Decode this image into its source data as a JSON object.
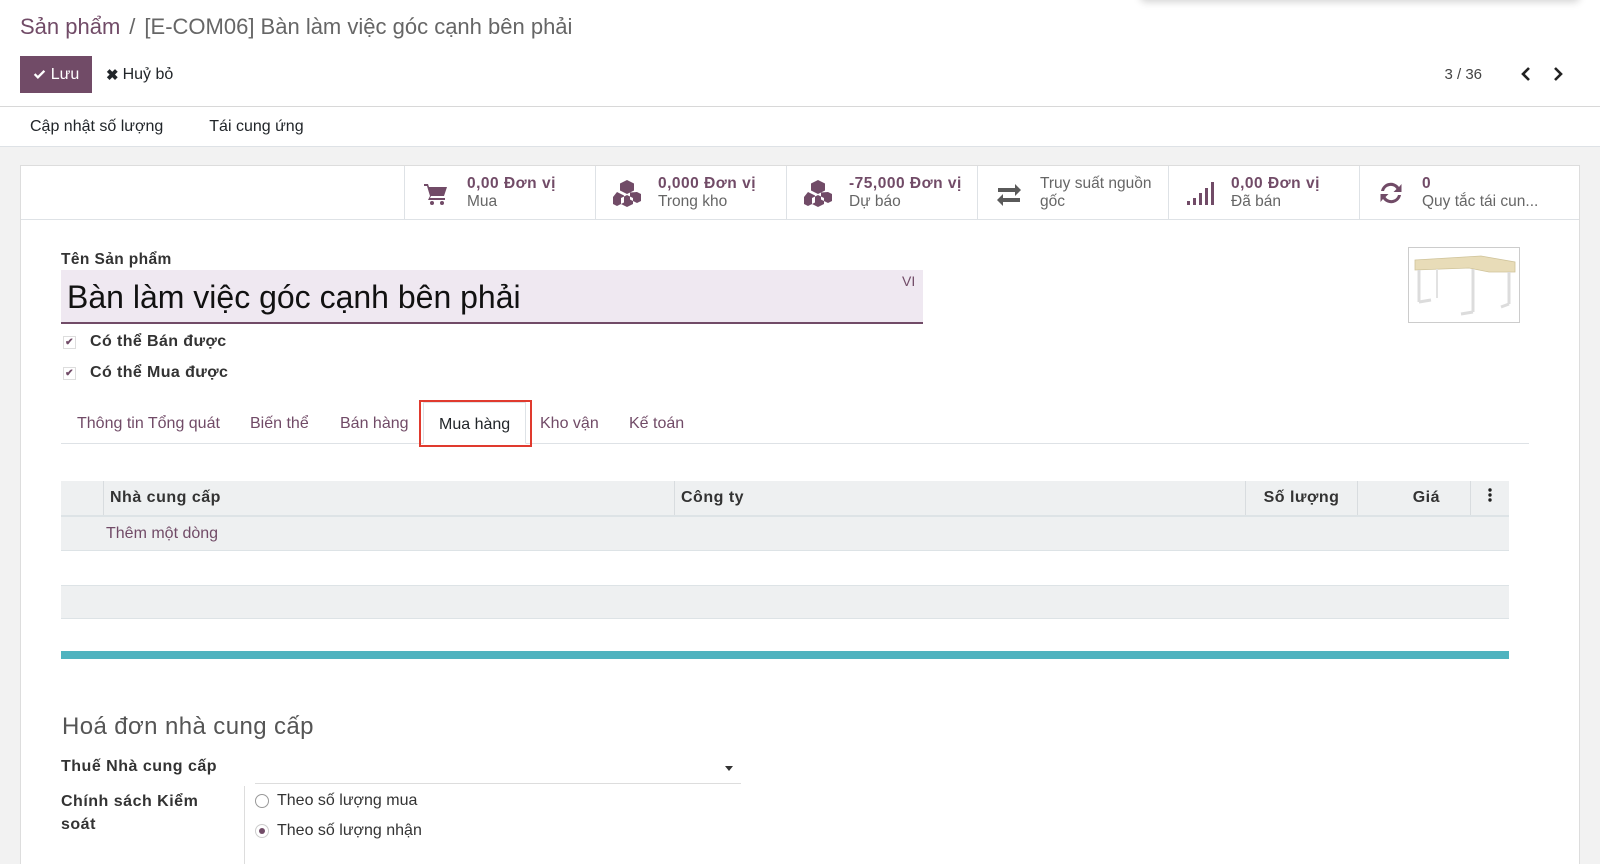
{
  "breadcrumb": {
    "parent": "Sản phẩm",
    "separator": "/",
    "current": "[E-COM06] Bàn làm việc góc cạnh bên phải"
  },
  "control_panel": {
    "save_label": "Lưu",
    "discard_label": "Huỷ bỏ",
    "pager_value": "3 / 36"
  },
  "statusbar": {
    "buttons": [
      "Cập nhật số lượng",
      "Tái cung ứng"
    ]
  },
  "stat_buttons": [
    {
      "icon": "shopping-cart-icon",
      "value": "0,00 Đơn vị",
      "label": "Mua"
    },
    {
      "icon": "cubes-icon",
      "value": "0,000 Đơn vị",
      "label": "Trong kho"
    },
    {
      "icon": "cubes-icon",
      "value": "-75,000 Đơn vị",
      "label": "Dự báo"
    },
    {
      "icon": "exchange-icon",
      "value": "",
      "label": "Truy suất nguồn gốc"
    },
    {
      "icon": "signal-icon",
      "value": "0,00 Đơn vị",
      "label": "Đã bán"
    },
    {
      "icon": "refresh-icon",
      "value": "0",
      "label": "Quy tắc tái cun..."
    }
  ],
  "product": {
    "name_label": "Tên Sản phẩm",
    "name": "Bàn làm việc góc cạnh bên phải",
    "lang": "VI",
    "can_be_sold_label": "Có thể Bán được",
    "can_be_sold": true,
    "can_be_purchased_label": "Có thể Mua được",
    "can_be_purchased": true
  },
  "tabs": [
    {
      "label": "Thông tin Tổng quát",
      "active": false
    },
    {
      "label": "Biến thể",
      "active": false
    },
    {
      "label": "Bán hàng",
      "active": false
    },
    {
      "label": "Mua hàng",
      "active": true
    },
    {
      "label": "Kho vận",
      "active": false
    },
    {
      "label": "Kế toán",
      "active": false
    }
  ],
  "vendor_table": {
    "columns": [
      "Nhà cung cấp",
      "Công ty",
      "Số lượng",
      "Giá"
    ],
    "add_line_label": "Thêm một dòng",
    "rows": []
  },
  "vendor_bills": {
    "title": "Hoá đơn nhà cung cấp",
    "vendor_taxes_label": "Thuế Nhà cung cấp",
    "vendor_taxes_value": "",
    "control_policy_label": "Chính sách Kiểm soát",
    "control_policy_options": [
      "Theo số lượng mua",
      "Theo số lượng nhận"
    ],
    "control_policy_selected": "Theo số lượng nhận"
  },
  "colors": {
    "brand": "#714B67",
    "accent_bar": "#4fb3bf",
    "highlight_box": "#e03a2e"
  }
}
